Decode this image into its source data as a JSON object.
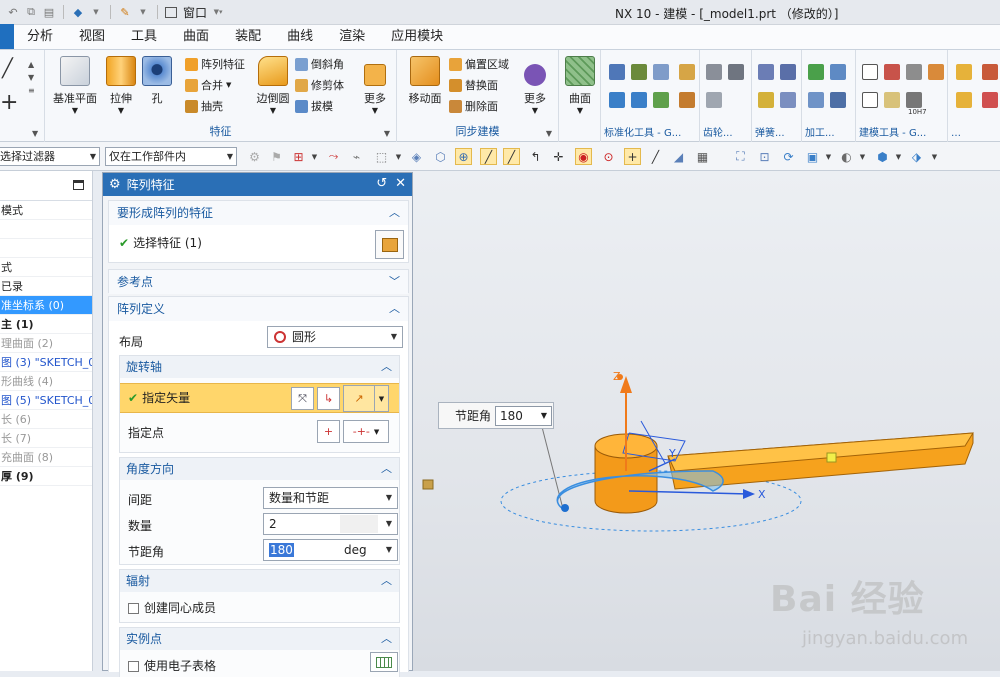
{
  "window": {
    "title": "NX 10 - 建模 - [_model1.prt （修改的）]",
    "window_menu": "窗口"
  },
  "menubar": [
    "分析",
    "视图",
    "工具",
    "曲面",
    "装配",
    "曲线",
    "渲染",
    "应用模块"
  ],
  "ribbon": {
    "feature_group": {
      "label": "特征",
      "big": [
        "基准平面",
        "拉伸",
        "孔",
        "边倒圆",
        "更多"
      ],
      "small": [
        "阵列特征",
        "合并",
        "抽壳",
        "倒斜角",
        "修剪体",
        "拔模"
      ]
    },
    "sync_group": {
      "label": "同步建模",
      "big": [
        "移动面",
        "更多"
      ],
      "small": [
        "偏置区域",
        "替换面",
        "删除面"
      ]
    },
    "surface": "曲面",
    "std_tools": "标准化工具 - G...",
    "gear": "齿轮...",
    "spring": "弹簧...",
    "machining": "加工...",
    "build_tools": "建模工具 - G...",
    "dots": "…",
    "h7": "10H7"
  },
  "toolbar2": {
    "filter": "选择过滤器",
    "scope": "仅在工作部件内"
  },
  "navigator": {
    "items": [
      {
        "text": "模式",
        "style": ""
      },
      {
        "text": "",
        "style": ""
      },
      {
        "text": "",
        "style": ""
      },
      {
        "text": "式",
        "style": ""
      },
      {
        "text": "已录",
        "style": ""
      },
      {
        "text": "准坐标系 (0)",
        "style": "sel-i"
      },
      {
        "text": "主 (1)",
        "style": "bold"
      },
      {
        "text": "理曲面 (2)",
        "style": "gray"
      },
      {
        "text": "图 (3) \"SKETCH_0...",
        "style": "blue"
      },
      {
        "text": "形曲线 (4)",
        "style": "gray"
      },
      {
        "text": "图 (5) \"SKETCH_0...",
        "style": "blue"
      },
      {
        "text": "长 (6)",
        "style": "gray"
      },
      {
        "text": "长 (7)",
        "style": "gray"
      },
      {
        "text": "充曲面 (8)",
        "style": "gray"
      },
      {
        "text": "厚 (9)",
        "style": "bold"
      }
    ]
  },
  "dialog": {
    "title": "阵列特征",
    "sec_features": {
      "title": "要形成阵列的特征",
      "select": "选择特征 (1)"
    },
    "sec_ref": {
      "title": "参考点"
    },
    "sec_def": {
      "title": "阵列定义",
      "layout_label": "布局",
      "layout_value": "圆形"
    },
    "rot_axis": {
      "title": "旋转轴",
      "vector": "指定矢量",
      "point": "指定点"
    },
    "angle_dir": {
      "title": "角度方向",
      "spacing_label": "间距",
      "spacing_value": "数量和节距",
      "count_label": "数量",
      "count_value": "2",
      "pitch_label": "节距角",
      "pitch_value": "180",
      "pitch_unit": "deg"
    },
    "radial": {
      "title": "辐射",
      "concentric": "创建同心成员"
    },
    "instance": {
      "title": "实例点",
      "spreadsheet": "使用电子表格"
    }
  },
  "viewport": {
    "float_label": "节距角",
    "float_value": "180",
    "axis_x": "X",
    "axis_y": "Y",
    "axis_z": "Z",
    "watermark": "Bai 经验",
    "watermark_url": "jingyan.baidu.com"
  },
  "colors": {
    "accent": "#2a6fb6",
    "highlight": "#ffd66b",
    "part": "#f6a21d"
  }
}
